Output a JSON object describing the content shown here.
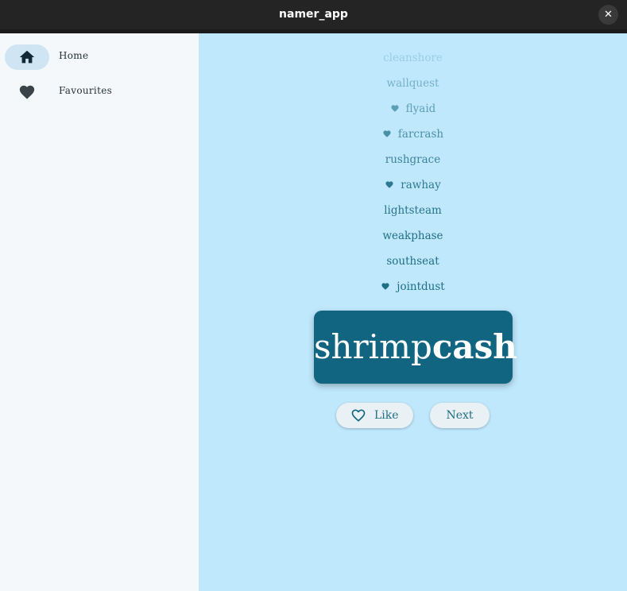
{
  "window": {
    "title": "namer_app",
    "close_glyph": "✕"
  },
  "sidebar": {
    "items": [
      {
        "label": "Home",
        "icon": "home-icon",
        "active": true
      },
      {
        "label": "Favourites",
        "icon": "heart-icon",
        "active": false
      }
    ]
  },
  "history": [
    {
      "word": "cleanshore",
      "liked": false
    },
    {
      "word": "wallquest",
      "liked": false
    },
    {
      "word": "flyaid",
      "liked": true
    },
    {
      "word": "farcrash",
      "liked": true
    },
    {
      "word": "rushgrace",
      "liked": false
    },
    {
      "word": "rawhay",
      "liked": true
    },
    {
      "word": "lightsteam",
      "liked": false
    },
    {
      "word": "weakphase",
      "liked": false
    },
    {
      "word": "southseat",
      "liked": false
    },
    {
      "word": "jointdust",
      "liked": true
    }
  ],
  "current_pair": {
    "first": "shrimp",
    "second": "cash"
  },
  "buttons": {
    "like_label": "Like",
    "next_label": "Next"
  },
  "colors": {
    "primary": "#116580",
    "background": "#bfe8fc",
    "history_text": "#1f6e84",
    "sidebar_active": "#cfe5f3",
    "titlebar": "#242424"
  }
}
